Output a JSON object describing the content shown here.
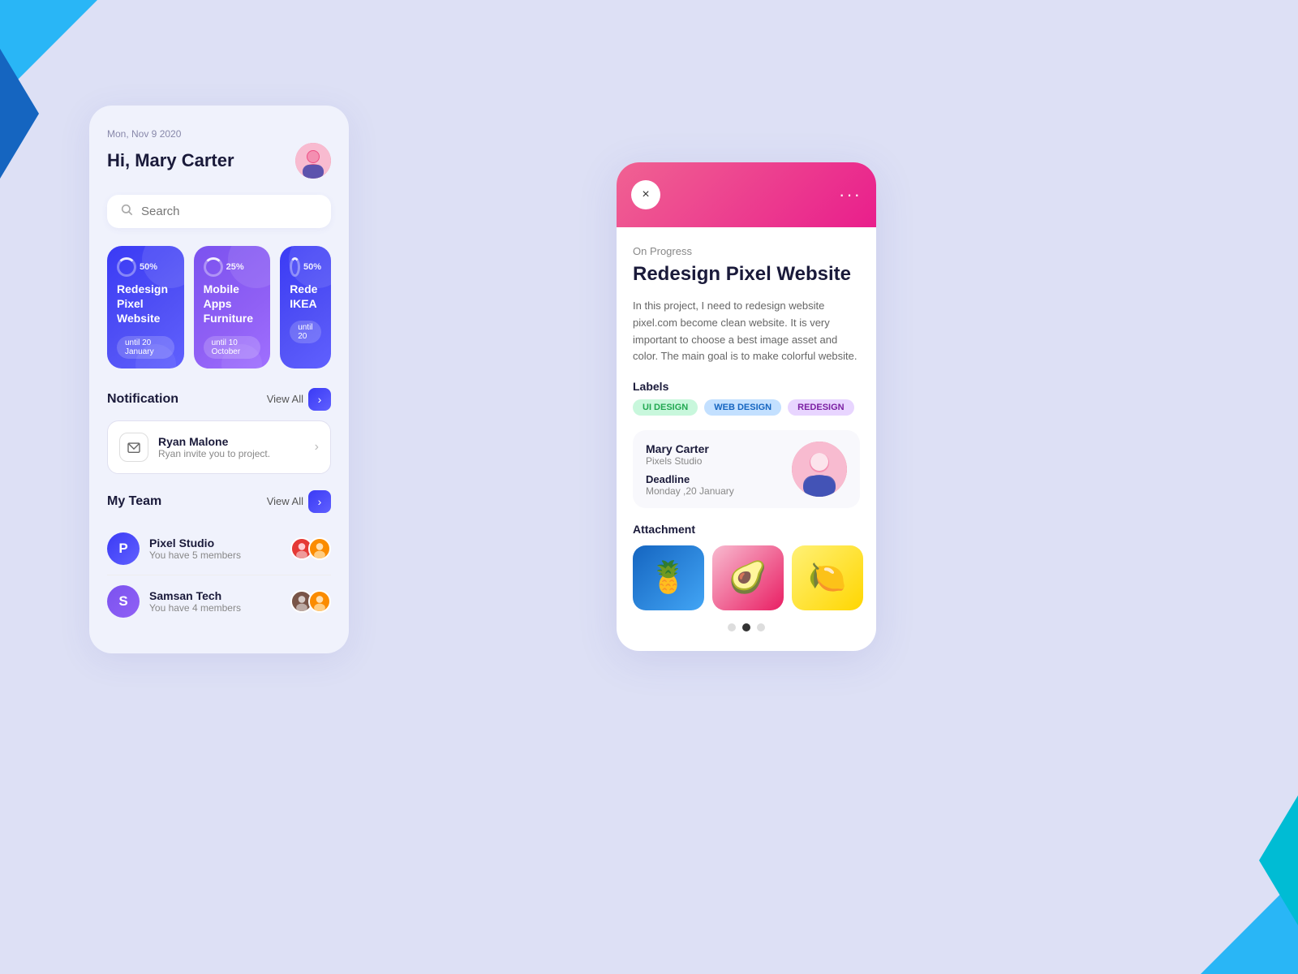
{
  "background": "#dde0f5",
  "header": {
    "date": "Mon, Nov 9 2020",
    "greeting": "Hi, Mary Carter",
    "avatar_alt": "Mary Carter avatar"
  },
  "search": {
    "placeholder": "Search"
  },
  "projects": [
    {
      "title": "Redesign Pixel Website",
      "progress": "50%",
      "date": "until 20 January",
      "color": "blue"
    },
    {
      "title": "Mobile Apps Furniture",
      "progress": "25%",
      "date": "until 10 October",
      "color": "purple"
    },
    {
      "title": "Rede IKEA",
      "progress": "50%",
      "date": "until 20",
      "color": "blue"
    }
  ],
  "notification": {
    "section_title": "Notification",
    "view_all": "View All",
    "item": {
      "name": "Ryan Malone",
      "message": "Ryan invite you to project."
    }
  },
  "my_team": {
    "section_title": "My Team",
    "view_all": "View All",
    "teams": [
      {
        "letter": "P",
        "name": "Pixel Studio",
        "members": "You have 5 members",
        "color": "blue"
      },
      {
        "letter": "S",
        "name": "Samsan Tech",
        "members": "You have 4 members",
        "color": "purple"
      }
    ]
  },
  "detail": {
    "close_label": "×",
    "more_label": "···",
    "status": "On Progress",
    "title": "Redesign Pixel Website",
    "description": "In this project, I need to redesign website pixel.com become clean website. It is very important to choose a best image asset and color. The main goal is to make colorful website.",
    "labels_title": "Labels",
    "labels": [
      "UI DESIGN",
      "WEB DESIGN",
      "REDESIGN"
    ],
    "user_name": "Mary Carter",
    "user_org": "Pixels Studio",
    "deadline_label": "Deadline",
    "deadline_date": "Monday ,20 January",
    "attachment_title": "Attachment",
    "carousel_dots": [
      {
        "active": false
      },
      {
        "active": true
      },
      {
        "active": false
      }
    ]
  }
}
